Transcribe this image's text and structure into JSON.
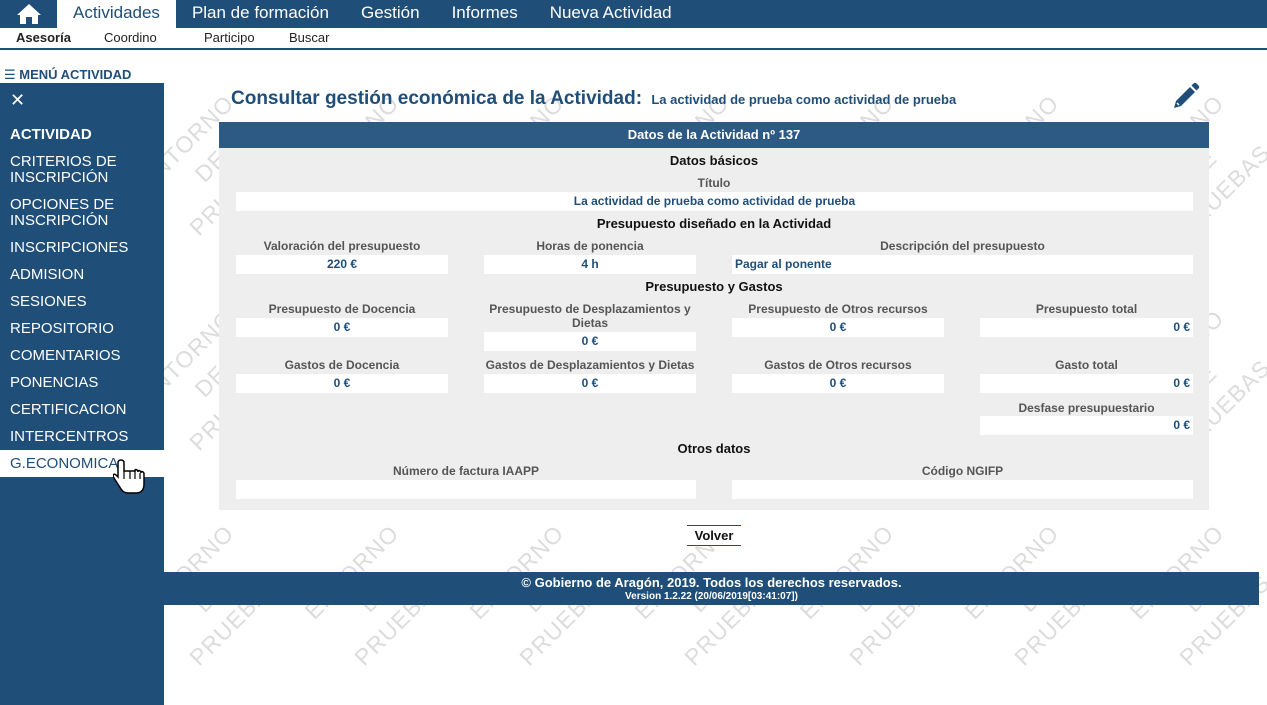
{
  "watermark": [
    "ENTORNO",
    "DE",
    "PRUEBAS"
  ],
  "topnav": {
    "home_icon": "home-icon",
    "items": [
      "Actividades",
      "Plan de formación",
      "Gestión",
      "Informes",
      "Nueva Actividad"
    ]
  },
  "subnav": {
    "items": [
      "Asesoría",
      "Coordino",
      "Participo",
      "Buscar"
    ]
  },
  "sidebar": {
    "menu_title": "☰ MENÚ ACTIVIDAD",
    "close": "✕",
    "items": [
      "ACTIVIDAD",
      "CRITERIOS DE INSCRIPCIÓN",
      "OPCIONES DE INSCRIPCIÓN",
      "INSCRIPCIONES",
      "ADMISION",
      "SESIONES",
      "REPOSITORIO",
      "COMENTARIOS",
      "PONENCIAS",
      "CERTIFICACION",
      "INTERCENTROS",
      "G.ECONOMICA"
    ]
  },
  "page": {
    "title": "Consultar gestión económica de la Actividad:",
    "subtitle": "La actividad de prueba como actividad de prueba"
  },
  "panel": {
    "header": "Datos de la Actividad nº 137",
    "basic": {
      "section": "Datos básicos",
      "titulo_label": "Título",
      "titulo_value": "La actividad de prueba como actividad de prueba"
    },
    "budget_design": {
      "section": "Presupuesto diseñado en la Actividad",
      "valoracion_label": "Valoración del presupuesto",
      "valoracion_value": "220 €",
      "horas_label": "Horas de ponencia",
      "horas_value": "4 h",
      "descripcion_label": "Descripción del presupuesto",
      "descripcion_value": "Pagar al ponente"
    },
    "budget": {
      "section": "Presupuesto y Gastos",
      "pres_docencia_label": "Presupuesto de Docencia",
      "pres_docencia_value": "0 €",
      "pres_desplaz_label": "Presupuesto de Desplazamientos y Dietas",
      "pres_desplaz_value": "0 €",
      "pres_otros_label": "Presupuesto de Otros recursos",
      "pres_otros_value": "0 €",
      "pres_total_label": "Presupuesto total",
      "pres_total_value": "0 €",
      "gas_docencia_label": "Gastos de Docencia",
      "gas_docencia_value": "0 €",
      "gas_desplaz_label": "Gastos de Desplazamientos y Dietas",
      "gas_desplaz_value": "0 €",
      "gas_otros_label": "Gastos de Otros recursos",
      "gas_otros_value": "0 €",
      "gas_total_label": "Gasto total",
      "gas_total_value": "0 €",
      "desfase_label": "Desfase presupuestario",
      "desfase_value": "0 €"
    },
    "other": {
      "section": "Otros datos",
      "factura_label": "Número de factura IAAPP",
      "factura_value": "",
      "ngifp_label": "Código NGIFP",
      "ngifp_value": ""
    }
  },
  "volver": "Volver",
  "footer": {
    "line1": "© Gobierno de Aragón, 2019. Todos los derechos reservados.",
    "line2": "Version 1.2.22 (20/06/2019[03:41:07])"
  },
  "colors": {
    "primary": "#1f4e79",
    "panel": "#eeeeee",
    "panel_header": "#2c5a85"
  }
}
